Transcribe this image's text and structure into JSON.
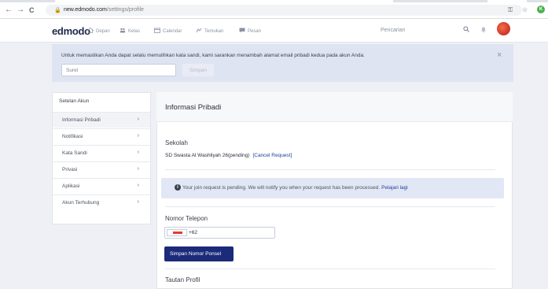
{
  "browser": {
    "url_host": "new.edmodo.com",
    "url_path": "/settings/profile",
    "back_glyph": "←",
    "forward_glyph": "→",
    "reload_glyph": "C",
    "lock_glyph": "🔒",
    "key_glyph": "⚿",
    "star_glyph": "☆",
    "profile_initial": "K",
    "icons": [
      "back-icon",
      "forward-icon",
      "reload-icon",
      "lock-icon",
      "key-icon",
      "star-icon"
    ]
  },
  "header": {
    "logo": "edmodo",
    "nav": [
      {
        "label": "Depan",
        "icon": "home-icon"
      },
      {
        "label": "Kelas",
        "icon": "classes-icon"
      },
      {
        "label": "Calendar",
        "icon": "calendar-icon"
      },
      {
        "label": "Temukan",
        "icon": "discover-icon"
      },
      {
        "label": "Pesan",
        "icon": "message-icon"
      }
    ],
    "search_placeholder": "Pencarian"
  },
  "banner": {
    "message": "Untuk memastikan Anda dapat selalu memulihkan kata sandi, kami sarankan menambah alamat email pribadi kedua pada akun Anda.",
    "email_placeholder": "Surel",
    "save_label": "Simpan",
    "close_glyph": "×"
  },
  "sidebar": {
    "header": "Setelan Akun",
    "chevron": "›",
    "items": [
      {
        "label": "Informasi Pribadi",
        "active": true
      },
      {
        "label": "Notifikasi",
        "active": false
      },
      {
        "label": "Kata Sandi",
        "active": false
      },
      {
        "label": "Privasi",
        "active": false
      },
      {
        "label": "Aplikasi",
        "active": false
      },
      {
        "label": "Akun Terhubung",
        "active": false
      }
    ]
  },
  "main": {
    "title": "Informasi Pribadi",
    "school_section": "Sekolah",
    "school_name": "SD Swasta Al Washliyah 26(pending)",
    "cancel_request": "[Cancel Request]",
    "notice": "Your join request is pending. We will notify you when your request has been processed.",
    "learn_more": "Pelajari lagi",
    "phone_section": "Nomor Telepon",
    "phone_code": "+62",
    "phone_save_label": "Simpan Nomor Ponsel",
    "profile_link_section": "Tautan Profil"
  },
  "colors": {
    "primary": "#1b2b7a",
    "link": "#1f3f9f",
    "banner_bg": "#dfe4f3"
  }
}
